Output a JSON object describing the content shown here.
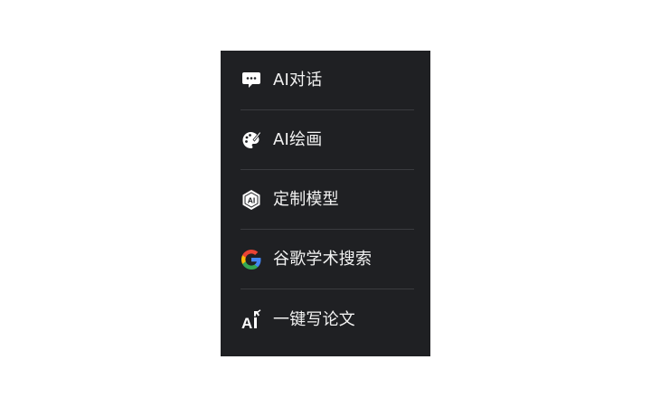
{
  "menu": {
    "items": [
      {
        "label": "AI对话",
        "icon": "chat-bubble-icon"
      },
      {
        "label": "AI绘画",
        "icon": "palette-brush-icon"
      },
      {
        "label": "定制模型",
        "icon": "ai-hexagon-icon"
      },
      {
        "label": "谷歌学术搜索",
        "icon": "google-g-icon"
      },
      {
        "label": "一键写论文",
        "icon": "ai-pen-icon"
      }
    ]
  },
  "colors": {
    "menu_background": "#1f2023",
    "divider": "#3a3b3f",
    "text": "#f2f2f2",
    "google_blue": "#4285F4",
    "google_red": "#EA4335",
    "google_yellow": "#FBBC05",
    "google_green": "#34A853"
  }
}
